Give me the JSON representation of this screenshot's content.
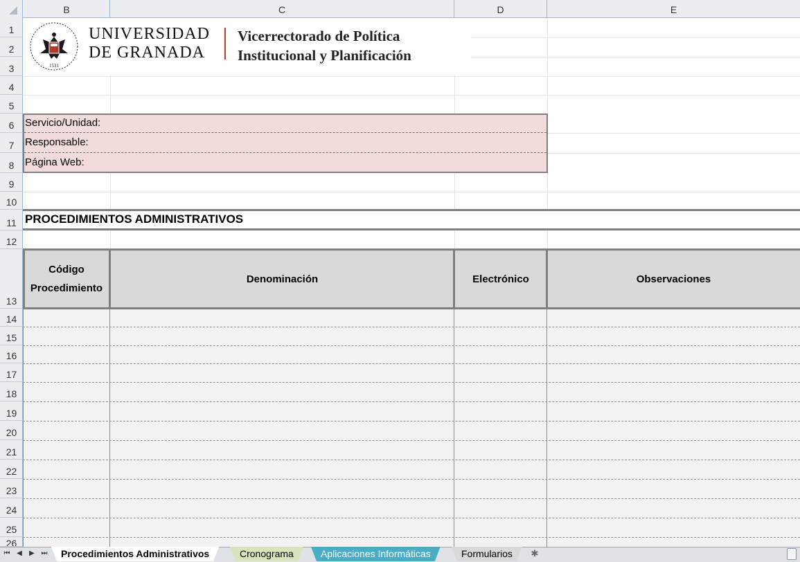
{
  "columns": [
    "B",
    "C",
    "D",
    "E"
  ],
  "rows": [
    "1",
    "2",
    "3",
    "4",
    "5",
    "6",
    "7",
    "8",
    "9",
    "10",
    "11",
    "12",
    "13",
    "14",
    "15",
    "16",
    "17",
    "18",
    "19",
    "20",
    "21",
    "22",
    "23",
    "24",
    "25",
    "26"
  ],
  "header": {
    "university_line1": "UNIVERSIDAD",
    "university_line2": "DE GRANADA",
    "vice_line1": "Vicerrectorado de Política",
    "vice_line2": "Institucional y Planificación",
    "seal_year": "1531",
    "accent_color": "#c0392b"
  },
  "info": {
    "service_label": "Servicio/Unidad:",
    "responsible_label": "Responsable:",
    "web_label": "Página Web:",
    "fill_color": "#f2dcdb"
  },
  "section": {
    "title": "PROCEDIMIENTOS ADMINISTRATIVOS"
  },
  "table": {
    "headers": {
      "code_line1": "Código",
      "code_line2": "Procedimiento",
      "denomination": "Denominación",
      "electronic": "Electrónico",
      "observations": "Observaciones"
    },
    "header_fill": "#d9d9d9",
    "body_fill": "#f2f2f2"
  },
  "tabs": [
    {
      "label": "Procedimientos Administrativos",
      "active": true,
      "color": "#ffffff"
    },
    {
      "label": "Cronograma",
      "active": false,
      "color": "#d8e4bc"
    },
    {
      "label": "Aplicaciones Informáticas",
      "active": false,
      "color": "#4bacc6"
    },
    {
      "label": "Formularios",
      "active": false,
      "color": "#d9d9d9"
    }
  ],
  "icons": {
    "nav": [
      "first-sheet-icon",
      "prev-sheet-icon",
      "next-sheet-icon",
      "last-sheet-icon"
    ],
    "new_sheet": "insert-worksheet-icon"
  }
}
